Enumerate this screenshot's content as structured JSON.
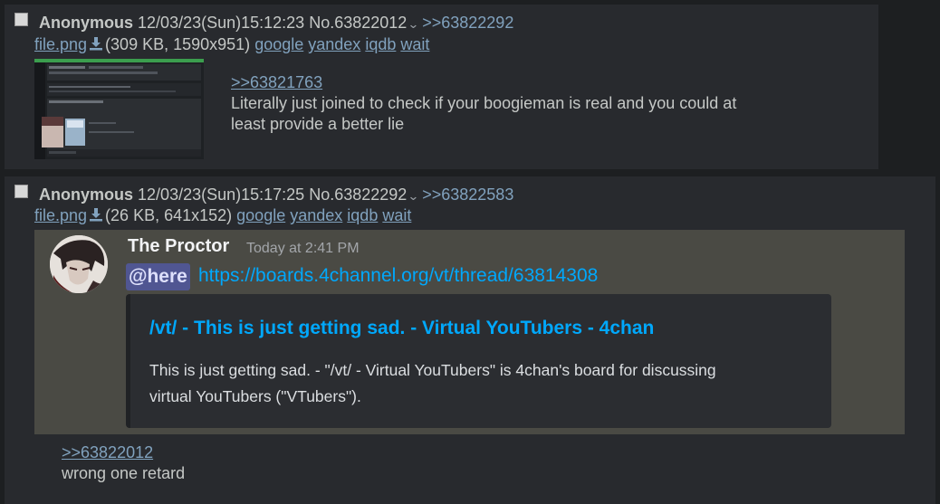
{
  "post1": {
    "name": "Anonymous",
    "datetime": "12/03/23(Sun)15:12:23",
    "number": "No.63822012",
    "backlink": ">>63822292",
    "file_link": "file.png",
    "file_meta": "(309 KB, 1590x951)",
    "search_links": [
      "google",
      "yandex",
      "iqdb",
      "wait"
    ],
    "quote_link": ">>63821763",
    "message_line1": "Literally just joined to check if your boogieman is real and you could at",
    "message_line2": "least provide a better lie"
  },
  "post2": {
    "name": "Anonymous",
    "datetime": "12/03/23(Sun)15:17:25",
    "number": "No.63822292",
    "backlink": ">>63822583",
    "file_link": "file.png",
    "file_meta": "(26 KB, 641x152)",
    "search_links": [
      "google",
      "yandex",
      "iqdb",
      "wait"
    ],
    "image": {
      "author": "The Proctor",
      "timestamp": "Today at 2:41 PM",
      "mention": "@here",
      "url": "https://boards.4channel.org/vt/thread/63814308",
      "embed_title": "/vt/ - This is just getting sad. - Virtual YouTubers - 4chan",
      "embed_desc_line1": "This is just getting sad. - \"/vt/ - Virtual YouTubers\" is 4chan's board for discussing",
      "embed_desc_line2": "virtual YouTubers (\"VTubers\")."
    },
    "quote_link": ">>63822012",
    "message": "wrong one retard"
  },
  "colors": {
    "background": "#1d1f21",
    "post_background": "#282a2e",
    "text": "#c5c8c6",
    "link": "#81a2be",
    "discord_link": "#00a8fc"
  },
  "icons": [
    "checkbox",
    "chevron-down-icon",
    "download-icon"
  ]
}
